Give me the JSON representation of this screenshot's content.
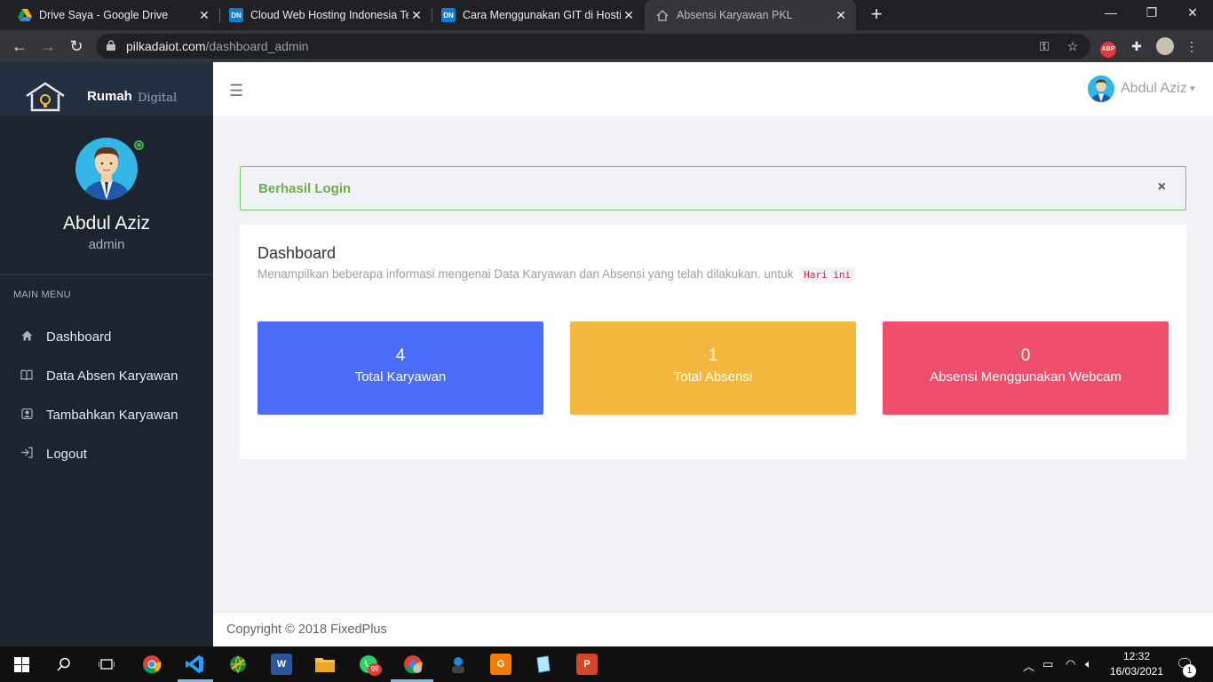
{
  "browser": {
    "tabs": [
      {
        "title": "Drive Saya - Google Drive",
        "icon": "google-drive-icon",
        "active": false
      },
      {
        "title": "Cloud Web Hosting Indonesia Te",
        "icon": "dn-icon",
        "active": false
      },
      {
        "title": "Cara Menggunakan GIT di Hostin",
        "icon": "dn-icon",
        "active": false
      },
      {
        "title": "Absensi Karyawan PKL",
        "icon": "home-icon",
        "active": true
      }
    ],
    "url_host": "pilkadaiot.com",
    "url_path": "/dashboard_admin"
  },
  "brand": {
    "name_bold": "Rumah",
    "name_light": "Digital"
  },
  "profile": {
    "name": "Abdul Aziz",
    "role": "admin"
  },
  "sidebar": {
    "heading": "MAIN MENU",
    "items": [
      {
        "label": "Dashboard",
        "icon": "home-icon"
      },
      {
        "label": "Data Absen Karyawan",
        "icon": "book-icon"
      },
      {
        "label": "Tambahkan Karyawan",
        "icon": "user-add-icon"
      },
      {
        "label": "Logout",
        "icon": "sign-out-icon"
      }
    ]
  },
  "topnav": {
    "user_name": "Abdul Aziz"
  },
  "alert": {
    "text": "Berhasil Login",
    "close": "×"
  },
  "dashboard": {
    "title": "Dashboard",
    "description": "Menampilkan beberapa informasi mengenai Data Karyawan dan Absensi yang telah dilakukan. untuk",
    "highlight": "Hari ini",
    "stats": [
      {
        "value": "4",
        "label": "Total Karyawan",
        "color": "#4a6cf7"
      },
      {
        "value": "1",
        "label": "Total Absensi",
        "color": "#f4b63f"
      },
      {
        "value": "0",
        "label": "Absensi Menggunakan Webcam",
        "color": "#f04f6c"
      }
    ]
  },
  "footer": {
    "text": "Copyright © 2018 FixedPlus"
  },
  "taskbar": {
    "time": "12:32",
    "date": "16/03/2021",
    "whatsapp_badge": "99",
    "notification_count": "1"
  }
}
